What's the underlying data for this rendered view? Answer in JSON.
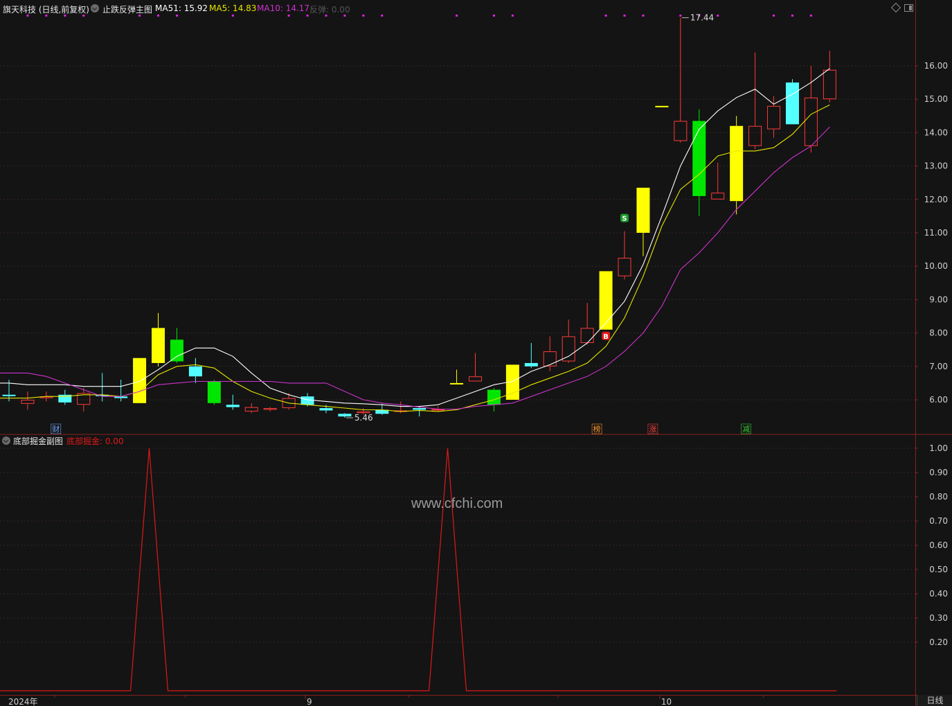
{
  "main_header": {
    "stock": "旗天科技 (日线,前复权)",
    "indicator": "止跌反弹主图",
    "ma51": "MA51: 15.92",
    "ma5": "MA5: 14.83",
    "ma10": "MA10: 14.17",
    "extra": "反弹: 0.00"
  },
  "sub_header": {
    "indicator": "底部掘金副图",
    "value": "底部掘金: 0.00"
  },
  "watermark": "www.cfchi.com",
  "period_tab": "日线",
  "colors": {
    "background": "#141414",
    "up": "#ff3a3a",
    "down_cyan": "#54ffff",
    "yellow_bar": "#ffff00",
    "green_bar": "#00e600",
    "ma51": "#ffffff",
    "ma5": "#e6e600",
    "ma10": "#cc33cc",
    "grid": "#3a2525",
    "signal": "#e01818",
    "axis_text": "#d0d0d0"
  },
  "chart_data": [
    {
      "type": "candlestick",
      "title": "止跌反弹主图",
      "ylim": [
        5.2,
        17.9
      ],
      "yticks": [
        "6.00",
        "7.00",
        "8.00",
        "9.00",
        "10.00",
        "11.00",
        "12.00",
        "13.00",
        "14.00",
        "15.00",
        "16.00"
      ],
      "yticks_values": [
        6,
        7,
        8,
        9,
        10,
        11,
        12,
        13,
        14,
        15,
        16
      ],
      "x_labels": [
        {
          "index": 16,
          "text": "9"
        },
        {
          "index": 35,
          "text": "10"
        }
      ],
      "bottom_left_label": "2024年",
      "annotations_price": [
        {
          "index": 36,
          "value": 17.44,
          "text": "17.44"
        },
        {
          "index": 18,
          "value": 5.46,
          "text": "5.46"
        }
      ],
      "markers": [
        {
          "index": 32,
          "text": "B",
          "color": "#e01818"
        },
        {
          "index": 33,
          "text": "S",
          "color": "#1a9a2a"
        }
      ],
      "bottom_tags": [
        {
          "index": 3,
          "text": "财",
          "color": "#6fa8ff"
        },
        {
          "index": 32,
          "text": "榜",
          "color": "#ff9a2a"
        },
        {
          "index": 35,
          "text": "涨",
          "color": "#ff4040"
        },
        {
          "index": 40,
          "text": "减",
          "color": "#33cc33"
        }
      ],
      "top_dot_indices": [
        1,
        2,
        3,
        4,
        7,
        8,
        9,
        12,
        15,
        16,
        17,
        18,
        19,
        20,
        24,
        26,
        27,
        32,
        33,
        34,
        36,
        37,
        38,
        41,
        42,
        43
      ],
      "candles": [
        {
          "o": 6.15,
          "h": 6.6,
          "c": 6.12,
          "l": 5.95,
          "style": "cyan"
        },
        {
          "o": 5.88,
          "h": 6.25,
          "c": 6.0,
          "l": 5.7,
          "style": "up"
        },
        {
          "o": 6.05,
          "h": 6.25,
          "c": 6.1,
          "l": 5.95,
          "style": "up"
        },
        {
          "o": 6.15,
          "h": 6.3,
          "c": 5.92,
          "l": 5.85,
          "style": "cyan"
        },
        {
          "o": 5.85,
          "h": 6.35,
          "c": 6.2,
          "l": 5.65,
          "style": "up"
        },
        {
          "o": 6.15,
          "h": 6.8,
          "c": 6.12,
          "l": 5.95,
          "style": "cyan"
        },
        {
          "o": 6.1,
          "h": 6.6,
          "c": 6.05,
          "l": 5.95,
          "style": "cyan"
        },
        {
          "o": 5.9,
          "h": 7.25,
          "c": 7.25,
          "l": 5.9,
          "style": "yellow"
        },
        {
          "o": 7.1,
          "h": 8.6,
          "c": 8.15,
          "l": 7.0,
          "style": "yellow"
        },
        {
          "o": 7.8,
          "h": 8.15,
          "c": 7.15,
          "l": 7.1,
          "style": "green"
        },
        {
          "o": 7.0,
          "h": 7.25,
          "c": 6.7,
          "l": 6.5,
          "style": "cyan"
        },
        {
          "o": 6.55,
          "h": 6.6,
          "c": 5.9,
          "l": 5.85,
          "style": "green"
        },
        {
          "o": 5.85,
          "h": 6.15,
          "c": 5.78,
          "l": 5.7,
          "style": "cyan"
        },
        {
          "o": 5.65,
          "h": 5.9,
          "c": 5.78,
          "l": 5.6,
          "style": "up"
        },
        {
          "o": 5.7,
          "h": 5.78,
          "c": 5.75,
          "l": 5.65,
          "style": "up"
        },
        {
          "o": 5.75,
          "h": 6.2,
          "c": 6.05,
          "l": 5.7,
          "style": "up"
        },
        {
          "o": 6.1,
          "h": 6.2,
          "c": 5.85,
          "l": 5.8,
          "style": "cyan"
        },
        {
          "o": 5.75,
          "h": 5.85,
          "c": 5.68,
          "l": 5.6,
          "style": "cyan"
        },
        {
          "o": 5.58,
          "h": 5.6,
          "c": 5.5,
          "l": 5.46,
          "style": "cyan"
        },
        {
          "o": 5.6,
          "h": 5.75,
          "c": 5.65,
          "l": 5.55,
          "style": "up"
        },
        {
          "o": 5.7,
          "h": 5.88,
          "c": 5.58,
          "l": 5.55,
          "style": "cyan"
        },
        {
          "o": 5.65,
          "h": 5.95,
          "c": 5.68,
          "l": 5.6,
          "style": "up"
        },
        {
          "o": 5.75,
          "h": 5.8,
          "c": 5.7,
          "l": 5.5,
          "style": "cyan"
        },
        {
          "o": 5.72,
          "h": 5.8,
          "c": 5.68,
          "l": 5.65,
          "style": "up"
        },
        {
          "o": 6.5,
          "h": 6.9,
          "c": 6.5,
          "l": 6.5,
          "style": "flat_yellow"
        },
        {
          "o": 6.55,
          "h": 7.4,
          "c": 6.7,
          "l": 6.55,
          "style": "up"
        },
        {
          "o": 6.3,
          "h": 6.35,
          "c": 5.85,
          "l": 5.65,
          "style": "green"
        },
        {
          "o": 6.0,
          "h": 7.05,
          "c": 7.05,
          "l": 6.0,
          "style": "yellow"
        },
        {
          "o": 7.1,
          "h": 7.7,
          "c": 7.0,
          "l": 6.95,
          "style": "cyan"
        },
        {
          "o": 7.0,
          "h": 7.9,
          "c": 7.45,
          "l": 6.85,
          "style": "up"
        },
        {
          "o": 7.15,
          "h": 8.4,
          "c": 7.9,
          "l": 7.1,
          "style": "up"
        },
        {
          "o": 7.7,
          "h": 8.9,
          "c": 8.15,
          "l": 7.65,
          "style": "up"
        },
        {
          "o": 8.1,
          "h": 9.85,
          "c": 9.85,
          "l": 8.1,
          "style": "yellow"
        },
        {
          "o": 9.7,
          "h": 11.05,
          "c": 10.25,
          "l": 9.6,
          "style": "up"
        },
        {
          "o": 11.0,
          "h": 12.35,
          "c": 12.35,
          "l": 10.3,
          "style": "yellow"
        },
        {
          "o": 14.8,
          "h": 14.8,
          "c": 14.8,
          "l": 14.8,
          "style": "flat_yellow"
        },
        {
          "o": 13.75,
          "h": 17.44,
          "c": 14.35,
          "l": 13.7,
          "style": "up"
        },
        {
          "o": 14.35,
          "h": 14.7,
          "c": 12.1,
          "l": 11.5,
          "style": "green"
        },
        {
          "o": 12.0,
          "h": 13.1,
          "c": 12.2,
          "l": 12.0,
          "style": "up"
        },
        {
          "o": 11.95,
          "h": 14.5,
          "c": 14.2,
          "l": 11.55,
          "style": "yellow"
        },
        {
          "o": 13.6,
          "h": 16.4,
          "c": 14.2,
          "l": 13.5,
          "style": "up"
        },
        {
          "o": 14.1,
          "h": 15.1,
          "c": 14.8,
          "l": 13.85,
          "style": "up"
        },
        {
          "o": 14.25,
          "h": 15.6,
          "c": 15.5,
          "l": 14.25,
          "style": "cyan"
        },
        {
          "o": 13.6,
          "h": 16.0,
          "c": 15.05,
          "l": 13.4,
          "style": "up"
        },
        {
          "o": 15.0,
          "h": 16.45,
          "c": 15.88,
          "l": 14.9,
          "style": "up"
        }
      ],
      "series": [
        {
          "name": "MA51",
          "values": [
            6.5,
            6.45,
            6.45,
            6.45,
            6.4,
            6.4,
            6.4,
            6.55,
            6.9,
            7.3,
            7.55,
            7.55,
            7.3,
            6.8,
            6.35,
            6.15,
            6.0,
            5.95,
            5.9,
            5.88,
            5.85,
            5.8,
            5.8,
            5.85,
            6.05,
            6.25,
            6.45,
            6.55,
            6.85,
            7.05,
            7.3,
            7.7,
            8.3,
            8.95,
            10.05,
            11.5,
            13.0,
            14.1,
            14.65,
            15.05,
            15.3,
            14.85,
            15.15,
            15.5,
            15.92
          ]
        },
        {
          "name": "MA5",
          "values": [
            6.05,
            6.05,
            6.1,
            6.1,
            6.15,
            6.15,
            6.1,
            6.25,
            6.75,
            7.0,
            7.05,
            6.95,
            6.55,
            6.25,
            6.05,
            5.9,
            5.85,
            5.8,
            5.75,
            5.7,
            5.7,
            5.65,
            5.68,
            5.65,
            5.7,
            5.85,
            6.0,
            6.2,
            6.45,
            6.65,
            6.85,
            7.1,
            7.6,
            8.45,
            9.7,
            11.2,
            12.3,
            12.75,
            13.3,
            13.45,
            13.45,
            13.55,
            13.95,
            14.55,
            14.83
          ]
        },
        {
          "name": "MA10",
          "values": [
            6.8,
            6.8,
            6.7,
            6.5,
            6.3,
            6.1,
            6.1,
            6.25,
            6.45,
            6.5,
            6.55,
            6.55,
            6.55,
            6.55,
            6.55,
            6.5,
            6.5,
            6.5,
            6.25,
            6.0,
            5.9,
            5.85,
            5.78,
            5.72,
            5.72,
            5.8,
            5.85,
            5.9,
            6.1,
            6.3,
            6.5,
            6.7,
            7.0,
            7.45,
            8.0,
            8.8,
            9.9,
            10.4,
            11.0,
            11.7,
            12.25,
            12.8,
            13.25,
            13.6,
            14.17
          ]
        }
      ]
    },
    {
      "type": "line",
      "title": "底部掘金副图",
      "ylim": [
        0,
        1.05
      ],
      "yticks": [
        "0.20",
        "0.30",
        "0.40",
        "0.50",
        "0.60",
        "0.70",
        "0.80",
        "0.90",
        "1.00"
      ],
      "yticks_values": [
        0.2,
        0.3,
        0.4,
        0.5,
        0.6,
        0.7,
        0.8,
        0.9,
        1.0
      ],
      "series": [
        {
          "name": "底部掘金",
          "values": [
            0,
            0,
            0,
            0,
            0,
            0,
            0,
            0,
            1,
            0,
            0,
            0,
            0,
            0,
            0,
            0,
            0,
            0,
            0,
            0,
            0,
            0,
            0,
            0,
            1,
            0,
            0,
            0,
            0,
            0,
            0,
            0,
            0,
            0,
            0,
            0,
            0,
            0,
            0,
            0,
            0,
            0,
            0,
            0,
            0
          ]
        }
      ]
    }
  ]
}
